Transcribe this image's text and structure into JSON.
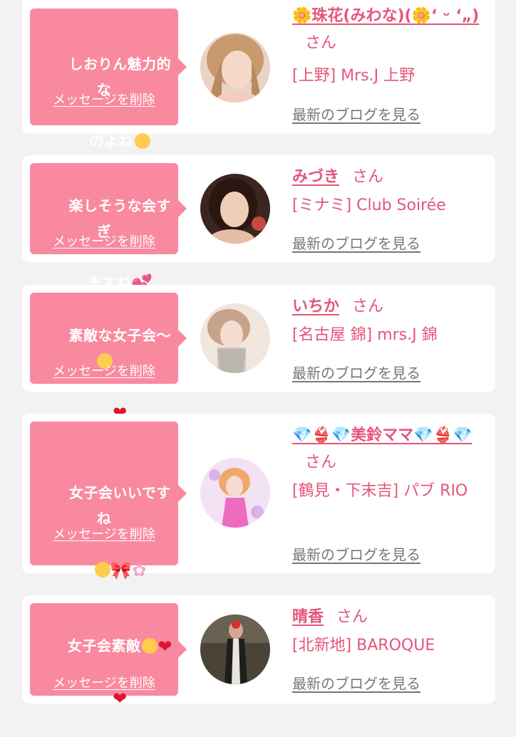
{
  "delete_label": "メッセージを削除",
  "blog_label": "最新のブログを見る",
  "honorific": "さん",
  "cards": [
    {
      "message_line1": "しおりん魅力的な",
      "message_line2": "のよね",
      "message_emoji": "pleading-face",
      "name": "🌼珠花(みわな)(🌼‘ ᵕ ‘„) ",
      "shop": "[上野] Mrs.J 上野",
      "avatar_icon": "avatar-blonde-woman"
    },
    {
      "message_line1": "楽しそうな会すぎ",
      "message_line2": "ますね",
      "message_emoji": "two-hearts",
      "name": "みづき",
      "shop": "[ミナミ] Club Soirée",
      "avatar_icon": "avatar-dark-hair-woman"
    },
    {
      "message_line1": "素敵な女子会〜",
      "message_line2": "",
      "message_emoji": "laughing-face heart",
      "name": "いちか",
      "shop": "[名古屋 錦] mrs.J 錦",
      "avatar_icon": "avatar-light-woman"
    },
    {
      "message_line1": "女子会いいですね",
      "message_line2": "",
      "message_emoji": "smile ribbon cherry-blossom",
      "name": "💎👙💎美鈴ママ💎👙💎",
      "shop": "[鶴見・下末吉] パブ RIO",
      "avatar_icon": "avatar-pink-hair-woman"
    },
    {
      "message_line1": "女子会素敵",
      "message_line2": "",
      "message_emoji": "drooling-face heart heart",
      "name": "晴香",
      "shop": "[北新地] BAROQUE",
      "avatar_icon": "avatar-black-dress-woman"
    }
  ],
  "colors": {
    "bubble": "#f9899f",
    "accent_text": "#e5557a",
    "link_gray": "#777777",
    "background": "#f2f2f2"
  }
}
